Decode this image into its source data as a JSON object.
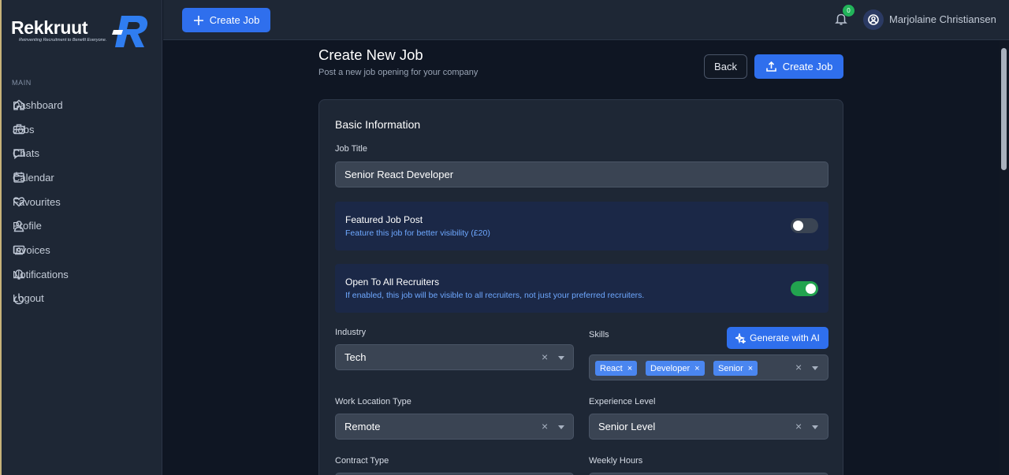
{
  "brand": {
    "name": "Rekkruut",
    "tagline": "Reinventing Recruitment to Benefit Everyone."
  },
  "sidebar": {
    "section_label": "MAIN",
    "items": [
      {
        "label": "Dashboard",
        "icon": "home-icon"
      },
      {
        "label": "Jobs",
        "icon": "briefcase-icon"
      },
      {
        "label": "Chats",
        "icon": "chat-icon"
      },
      {
        "label": "Calendar",
        "icon": "calendar-icon"
      },
      {
        "label": "Favourites",
        "icon": "heart-icon"
      },
      {
        "label": "Profile",
        "icon": "user-icon"
      },
      {
        "label": "Invoices",
        "icon": "invoice-icon"
      },
      {
        "label": "Notifications",
        "icon": "bell-icon"
      },
      {
        "label": "Logout",
        "icon": "logout-icon"
      }
    ]
  },
  "topbar": {
    "create_label": "Create Job",
    "notification_count": "0",
    "user_name": "Marjolaine Christiansen"
  },
  "page": {
    "title": "Create New Job",
    "subtitle": "Post a new job opening for your company",
    "back_label": "Back",
    "create_label": "Create Job"
  },
  "form": {
    "section_title": "Basic Information",
    "job_title_label": "Job Title",
    "job_title_value": "Senior React Developer",
    "featured": {
      "title": "Featured Job Post",
      "desc": "Feature this job for better visibility (£20)",
      "on": false
    },
    "open_recruiters": {
      "title": "Open To All Recruiters",
      "desc": "If enabled, this job will be visible to all recruiters, not just your preferred recruiters.",
      "on": true
    },
    "industry_label": "Industry",
    "industry_value": "Tech",
    "skills_label": "Skills",
    "generate_label": "Generate with AI",
    "skills": [
      "React",
      "Developer",
      "Senior"
    ],
    "work_location_label": "Work Location Type",
    "work_location_value": "Remote",
    "experience_label": "Experience Level",
    "experience_value": "Senior Level",
    "contract_label": "Contract Type",
    "weekly_hours_label": "Weekly Hours"
  },
  "colors": {
    "accent": "#2f6fed",
    "toggle_on": "#22a34f",
    "chip": "#4a86f0",
    "panel": "#1b2847"
  }
}
